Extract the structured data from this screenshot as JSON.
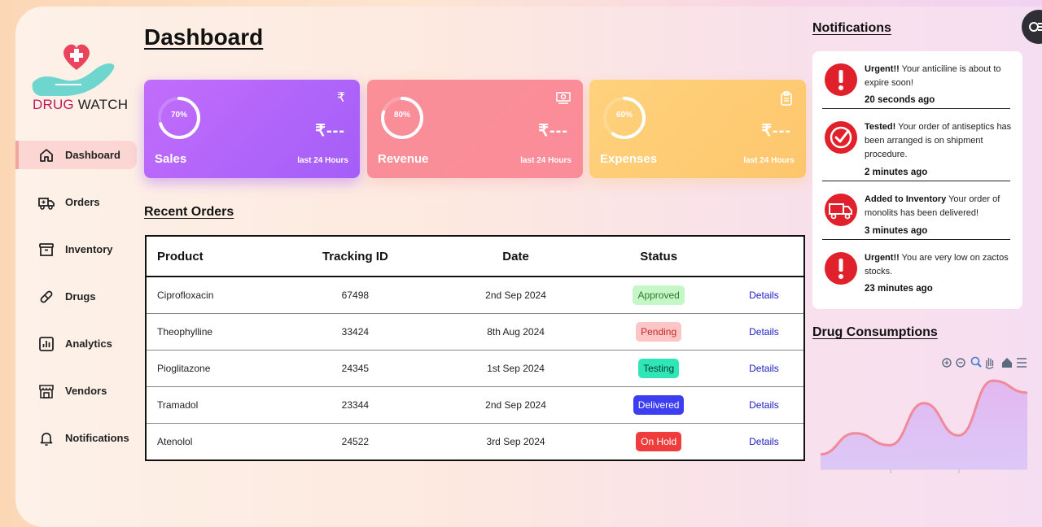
{
  "brand": {
    "part1": "DRUG ",
    "part2": "WATCH"
  },
  "sidebar": {
    "items": [
      {
        "label": "Dashboard",
        "icon": "home-icon",
        "active": true
      },
      {
        "label": "Orders",
        "icon": "truck-icon"
      },
      {
        "label": "Inventory",
        "icon": "archive-icon"
      },
      {
        "label": "Drugs",
        "icon": "pill-icon"
      },
      {
        "label": "Analytics",
        "icon": "bar-chart-icon"
      },
      {
        "label": "Vendors",
        "icon": "store-icon"
      },
      {
        "label": "Notifications",
        "icon": "bell-icon"
      }
    ]
  },
  "page": {
    "title": "Dashboard"
  },
  "cards": [
    {
      "name": "Sales",
      "percent": "70%",
      "percent_value": 70,
      "currency_icon": "₹",
      "amount": "₹---",
      "period": "last 24 Hours",
      "color": "#b066fa"
    },
    {
      "name": "Revenue",
      "percent": "80%",
      "percent_value": 80,
      "currency_icon": "money-icon",
      "amount": "₹---",
      "period": "last 24 Hours",
      "color": "#fb8e98"
    },
    {
      "name": "Expenses",
      "percent": "60%",
      "percent_value": 60,
      "currency_icon": "clipboard-icon",
      "amount": "₹---",
      "period": "last 24 Hours",
      "color": "#fecb74"
    }
  ],
  "recent_orders": {
    "title": "Recent Orders",
    "headers": [
      "Product",
      "Tracking ID",
      "Date",
      "Status"
    ],
    "rows": [
      {
        "product": "Ciprofloxacin",
        "tracking": "67498",
        "date": "2nd Sep 2024",
        "status": "Approved",
        "action": "Details"
      },
      {
        "product": "Theophylline",
        "tracking": "33424",
        "date": "8th Aug 2024",
        "status": "Pending",
        "action": "Details"
      },
      {
        "product": "Pioglitazone",
        "tracking": "24345",
        "date": "1st Sep 2024",
        "status": "Testing",
        "action": "Details"
      },
      {
        "product": "Tramadol",
        "tracking": "23344",
        "date": "2nd Sep 2024",
        "status": "Delivered",
        "action": "Details"
      },
      {
        "product": "Atenolol",
        "tracking": "24522",
        "date": "3rd Sep 2024",
        "status": "On Hold",
        "action": "Details"
      }
    ]
  },
  "notifications": {
    "title": "Notifications",
    "items": [
      {
        "icon": "exclamation-icon",
        "head": "Urgent!!",
        "text": " Your anticiline is about to expire soon!",
        "time": "20 seconds ago"
      },
      {
        "icon": "check-badge-icon",
        "head": "Tested!",
        "text": " Your order of antiseptics has been arranged is on shipment procedure.",
        "time": "2 minutes ago"
      },
      {
        "icon": "delivery-truck-icon",
        "head": "Added to Inventory",
        "text": " Your order of monolits has been delivered!",
        "time": "3 minutes ago"
      },
      {
        "icon": "exclamation-icon",
        "head": "Urgent!!",
        "text": " You are very low on zactos stocks.",
        "time": "23 minutes ago"
      }
    ]
  },
  "drug_consumptions": {
    "title": "Drug Consumptions",
    "toolbar": [
      "zoom-in-icon",
      "zoom-out-icon",
      "zoom-select-icon",
      "pan-icon",
      "reset-home-icon",
      "menu-icon"
    ]
  },
  "chart_data": {
    "type": "area",
    "title": "",
    "values": [
      20,
      48,
      32,
      88,
      45,
      118,
      102
    ],
    "color": "#f08a9a"
  }
}
